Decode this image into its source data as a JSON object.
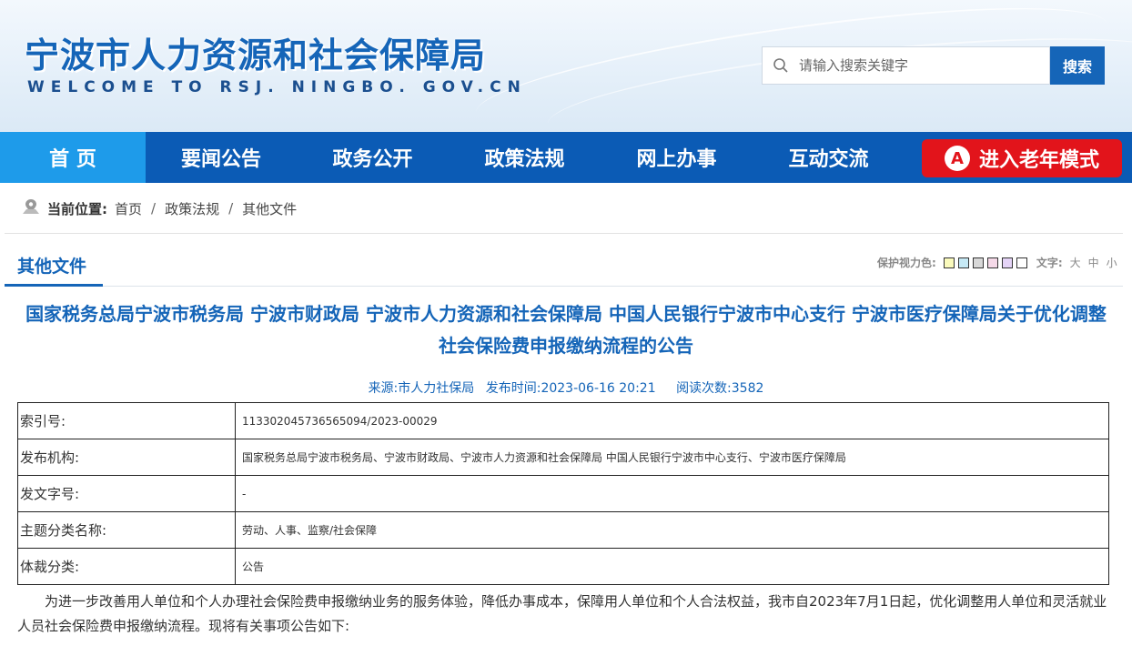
{
  "header": {
    "site_title": "宁波市人力资源和社会保障局",
    "site_subtitle": "WELCOME TO RSJ. NINGBO. GOV.CN",
    "search_placeholder": "请输入搜索关键字",
    "search_button": "搜索"
  },
  "nav": {
    "items": [
      {
        "label": "首 页"
      },
      {
        "label": "要闻公告"
      },
      {
        "label": "政务公开"
      },
      {
        "label": "政策法规"
      },
      {
        "label": "网上办事"
      },
      {
        "label": "互动交流"
      }
    ],
    "elder_mode_icon_letter": "A",
    "elder_mode_label": "进入老年模式",
    "active_color": "#1e9bea",
    "bar_color": "#0b5bb5"
  },
  "breadcrumb": {
    "label": "当前位置:",
    "items": [
      "首页",
      "政策法规",
      "其他文件"
    ],
    "separator": "/"
  },
  "section": {
    "title": "其他文件",
    "eye_color_label": "保护视力色:",
    "swatch_colors": [
      "#fafabc",
      "#c6e9f5",
      "#d8d8d8",
      "#f5d9e8",
      "#e5d4f7",
      "#ffffff"
    ],
    "font_label": "文字:",
    "font_sizes": [
      "大",
      "中",
      "小"
    ]
  },
  "article": {
    "title": "国家税务总局宁波市税务局 宁波市财政局 宁波市人力资源和社会保障局 中国人民银行宁波市中心支行 宁波市医疗保障局关于优化调整社会保险费申报缴纳流程的公告",
    "meta_source": "来源:市人力社保局",
    "meta_date": "发布时间:2023-06-16 20:21",
    "meta_views": "阅读次数:3582",
    "info": [
      {
        "key": "索引号:",
        "value": "113302045736565094/2023-00029"
      },
      {
        "key": "发布机构:",
        "value": "国家税务总局宁波市税务局、宁波市财政局、宁波市人力资源和社会保障局 中国人民银行宁波市中心支行、宁波市医疗保障局"
      },
      {
        "key": "发文字号:",
        "value": "-"
      },
      {
        "key": "主题分类名称:",
        "value": "劳动、人事、监察/社会保障"
      },
      {
        "key": "体裁分类:",
        "value": "公告"
      }
    ],
    "paragraph": "为进一步改善用人单位和个人办理社会保险费申报缴纳业务的服务体验，降低办事成本，保障用人单位和个人合法权益，我市自2023年7月1日起，优化调整用人单位和灵活就业人员社会保险费申报缴纳流程。现将有关事项公告如下:"
  }
}
